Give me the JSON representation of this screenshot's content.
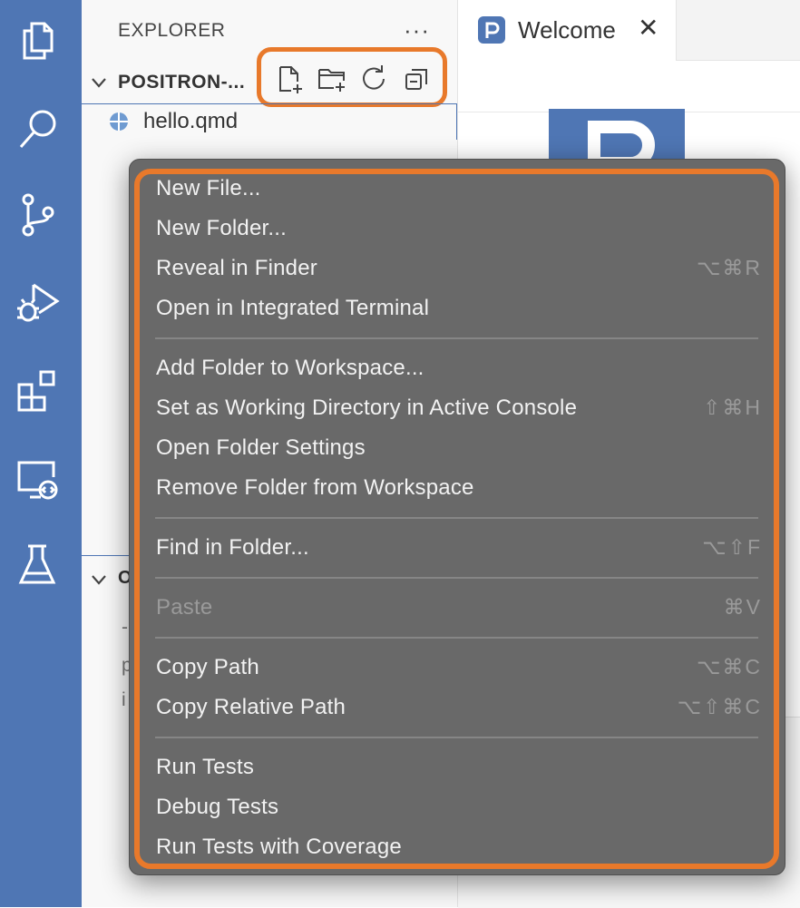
{
  "sidebar": {
    "title": "EXPLORER",
    "more": "···",
    "folder": "POSITRON-...",
    "file": "hello.qmd",
    "outline_label": "O",
    "faint_lines": [
      "-",
      "p",
      "i"
    ]
  },
  "editor": {
    "tab_label": "Welcome",
    "tab_close": "✕"
  },
  "menu": {
    "items": [
      {
        "label": "New File...",
        "shortcut": ""
      },
      {
        "label": "New Folder...",
        "shortcut": ""
      },
      {
        "label": "Reveal in Finder",
        "shortcut": "⌥⌘R"
      },
      {
        "label": "Open in Integrated Terminal",
        "shortcut": ""
      },
      {
        "label": "Add Folder to Workspace...",
        "shortcut": ""
      },
      {
        "label": "Set as Working Directory in Active Console",
        "shortcut": "⇧⌘H"
      },
      {
        "label": "Open Folder Settings",
        "shortcut": ""
      },
      {
        "label": "Remove Folder from Workspace",
        "shortcut": ""
      },
      {
        "label": "Find in Folder...",
        "shortcut": "⌥⇧F"
      },
      {
        "label": "Paste",
        "shortcut": "⌘V",
        "disabled": true
      },
      {
        "label": "Copy Path",
        "shortcut": "⌥⌘C"
      },
      {
        "label": "Copy Relative Path",
        "shortcut": "⌥⇧⌘C"
      },
      {
        "label": "Run Tests",
        "shortcut": ""
      },
      {
        "label": "Debug Tests",
        "shortcut": ""
      },
      {
        "label": "Run Tests with Coverage",
        "shortcut": ""
      }
    ]
  },
  "colors": {
    "activity_bar": "#4f76b4",
    "highlight": "#e8792b",
    "menu_bg": "#696969"
  }
}
